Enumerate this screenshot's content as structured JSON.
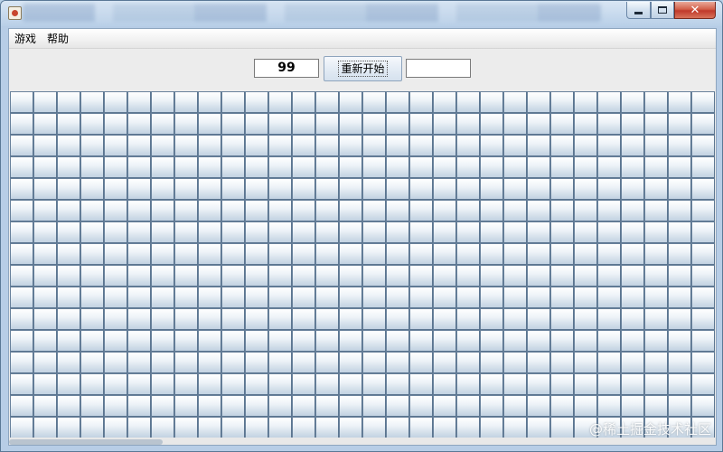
{
  "window": {
    "minimize_icon": "minimize-icon",
    "maximize_icon": "maximize-icon",
    "close_glyph": "✕"
  },
  "menu": {
    "items": [
      {
        "label": "游戏"
      },
      {
        "label": "帮助"
      }
    ]
  },
  "toolbar": {
    "mine_counter": "99",
    "restart_label": "重新开始",
    "timer_value": ""
  },
  "board": {
    "rows": 16,
    "columns": 30,
    "cell_state": "covered"
  },
  "watermark": "@稀土掘金技术社区",
  "colors": {
    "cell_top": "#ffffff",
    "cell_bottom": "#c2d2e2",
    "cell_border": "#68819b",
    "close_button": "#c0392b",
    "client_bg": "#ececec"
  }
}
